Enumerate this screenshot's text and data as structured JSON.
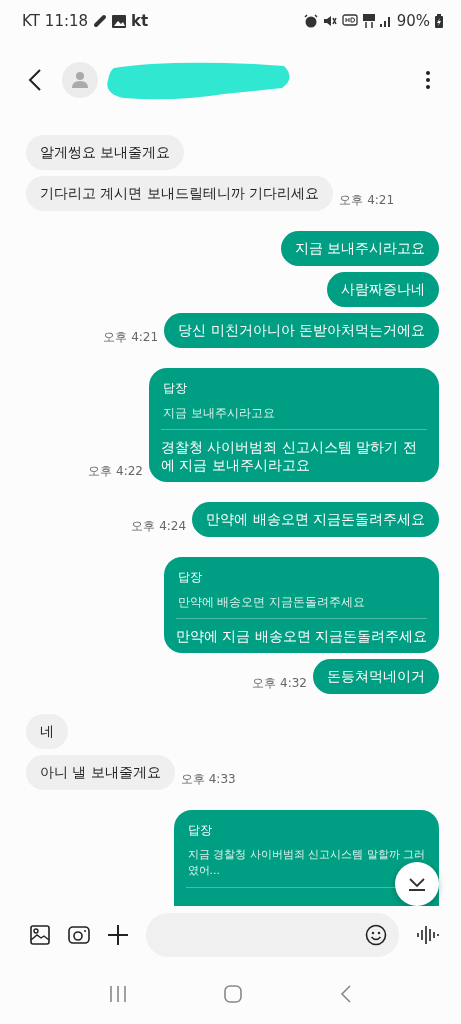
{
  "status_bar": {
    "carrier": "KT",
    "time": "11:18",
    "carrier_badge": "kt",
    "battery": "90%"
  },
  "messages": [
    {
      "kind": "in",
      "text": "알게썽요 보내줄게요"
    },
    {
      "kind": "in",
      "text": "기다리고 계시면 보내드릴테니까 기다리세요",
      "time": "오후 4:21"
    },
    {
      "kind": "out",
      "text": "지금 보내주시라고요"
    },
    {
      "kind": "out",
      "text": "사람짜증나네"
    },
    {
      "kind": "out",
      "text": "당신 미친거아니아 돈받아처먹는거에요",
      "time": "오후 4:21"
    },
    {
      "kind": "reply",
      "label": "답장",
      "quote": "지금 보내주시라고요",
      "text": "경찰청 사이버범죄 신고시스템 말하기 전에 지금 보내주시라고요",
      "time": "오후 4:22"
    },
    {
      "kind": "out",
      "text": "만약에 배송오면 지금돈돌려주세요",
      "time": "오후 4:24"
    },
    {
      "kind": "reply",
      "label": "답장",
      "quote": "만약에 배송오면 지금돈돌려주세요",
      "text": "만약에 지금 배송오면 지금돈돌려주세요"
    },
    {
      "kind": "out",
      "text": "돈등쳐먹네이거",
      "time": "오후 4:32"
    },
    {
      "kind": "in",
      "text": "네"
    },
    {
      "kind": "in",
      "text": "아니 낼 보내줄게요",
      "time": "오후 4:33"
    },
    {
      "kind": "reply",
      "label": "답장",
      "quote": "지금 경찰청 사이버범죄 신고시스템 말할까 그러",
      "quote_tail": "였어..."
    }
  ]
}
